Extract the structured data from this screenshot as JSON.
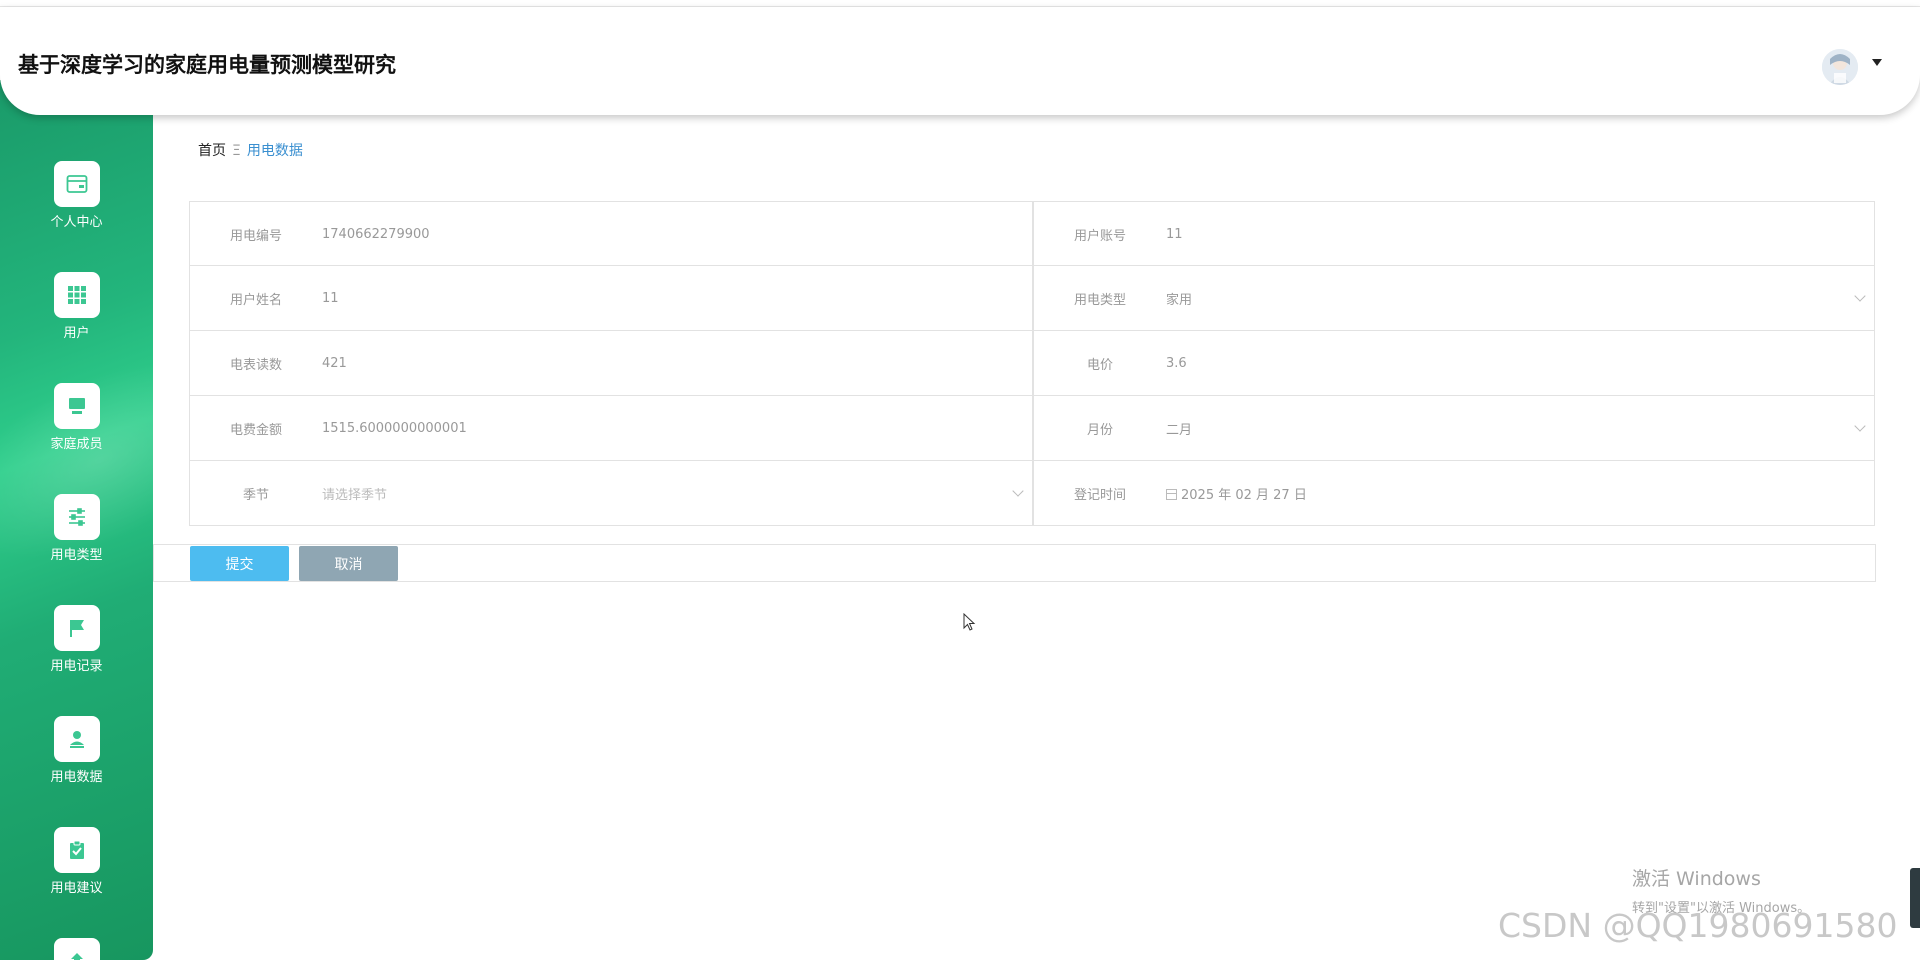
{
  "header": {
    "title": "基于深度学习的家庭用电量预测模型研究"
  },
  "sidebar": {
    "items": [
      {
        "label": "个人中心",
        "icon": "wallet-icon"
      },
      {
        "label": "用户",
        "icon": "grid-icon"
      },
      {
        "label": "家庭成员",
        "icon": "monitor-icon"
      },
      {
        "label": "用电类型",
        "icon": "sliders-icon"
      },
      {
        "label": "用电记录",
        "icon": "flag-icon"
      },
      {
        "label": "用电数据",
        "icon": "user-stamp-icon"
      },
      {
        "label": "用电建议",
        "icon": "clipboard-check-icon"
      }
    ]
  },
  "breadcrumb": {
    "home": "首页",
    "separator": "Ξ",
    "current": "用电数据"
  },
  "form": {
    "rows": [
      [
        {
          "label": "用电编号",
          "value": "1740662279900"
        },
        {
          "label": "用户账号",
          "value": "11"
        }
      ],
      [
        {
          "label": "用户姓名",
          "value": "11"
        },
        {
          "label": "用电类型",
          "value": "家用"
        }
      ],
      [
        {
          "label": "电表读数",
          "value": "421"
        },
        {
          "label": "电价",
          "value": "3.6"
        }
      ],
      [
        {
          "label": "电费金额",
          "value": "1515.6000000000001"
        },
        {
          "label": "月份",
          "value": "二月"
        }
      ],
      [
        {
          "label": "季节",
          "placeholder": "请选择季节"
        },
        {
          "label": "登记时间",
          "value": "2025 年 02 月 27 日"
        }
      ]
    ]
  },
  "buttons": {
    "submit": "提交",
    "cancel": "取消"
  },
  "overlay": {
    "activate_line1": "激活 Windows",
    "activate_line2": "转到\"设置\"以激活 Windows。",
    "watermark": "CSDN @QQ1980691580"
  },
  "colors": {
    "sidebar_green": "#23b57c",
    "submit_blue": "#4dbcf0",
    "cancel_gray": "#8fa6b3",
    "breadcrumb_link": "#3a8fd0"
  }
}
